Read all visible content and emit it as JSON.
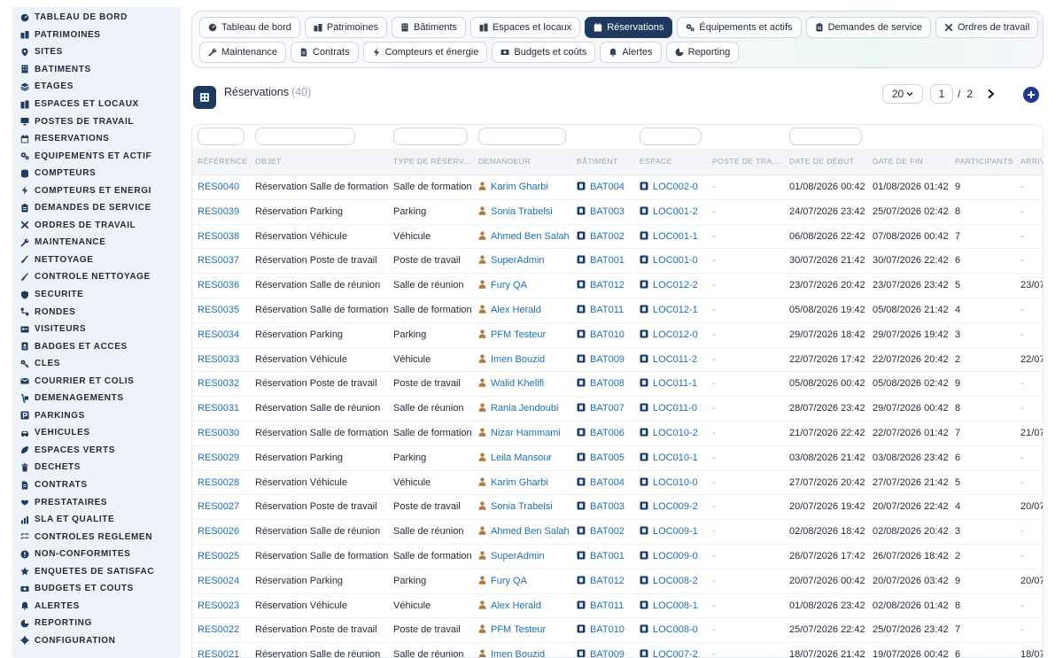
{
  "sidebar": {
    "items": [
      {
        "label": "TABLEAU DE BORD",
        "icon": "dashboard-icon"
      },
      {
        "label": "PATRIMOINES",
        "icon": "building-group-icon"
      },
      {
        "label": "SITES",
        "icon": "location-pin-icon"
      },
      {
        "label": "BÂTIMENTS",
        "icon": "building-icon"
      },
      {
        "label": "ÉTAGES",
        "icon": "layers-icon"
      },
      {
        "label": "ESPACES ET LOCAUX",
        "icon": "rooms-icon"
      },
      {
        "label": "POSTES DE TRAVAIL",
        "icon": "desktop-icon"
      },
      {
        "label": "RÉSERVATIONS",
        "icon": "calendar-icon"
      },
      {
        "label": "ÉQUIPEMENTS ET ACTIF",
        "icon": "cogs-icon"
      },
      {
        "label": "COMPTEURS",
        "icon": "database-icon"
      },
      {
        "label": "COMPTEURS ET ÉNERGI",
        "icon": "bolt-icon"
      },
      {
        "label": "DEMANDES DE SERVICE",
        "icon": "clipboard-icon"
      },
      {
        "label": "ORDRES DE TRAVAIL",
        "icon": "tools-icon"
      },
      {
        "label": "MAINTENANCE",
        "icon": "wrench-icon"
      },
      {
        "label": "NETTOYAGE",
        "icon": "broom-icon"
      },
      {
        "label": "CONTRÔLE NETTOYAGE",
        "icon": "check-broom-icon"
      },
      {
        "label": "SÉCURITÉ",
        "icon": "shield-icon"
      },
      {
        "label": "RONDES",
        "icon": "route-icon"
      },
      {
        "label": "VISITEURS",
        "icon": "id-card-icon"
      },
      {
        "label": "BADGES ET ACCÈS",
        "icon": "badge-icon"
      },
      {
        "label": "CLÉS",
        "icon": "key-icon"
      },
      {
        "label": "COURRIER ET COLIS",
        "icon": "mail-icon"
      },
      {
        "label": "DÉMÉNAGEMENTS",
        "icon": "dolly-icon"
      },
      {
        "label": "PARKINGS",
        "icon": "parking-icon"
      },
      {
        "label": "VÉHICULES",
        "icon": "car-icon"
      },
      {
        "label": "ESPACES VERTS",
        "icon": "leaf-icon"
      },
      {
        "label": "DÉCHETS",
        "icon": "trash-icon"
      },
      {
        "label": "CONTRATS",
        "icon": "document-icon"
      },
      {
        "label": "PRESTATAIRES",
        "icon": "handshake-icon"
      },
      {
        "label": "SLA ET QUALITÉ",
        "icon": "chart-icon"
      },
      {
        "label": "CONTRÔLES RÉGLEMEN",
        "icon": "checklist-icon"
      },
      {
        "label": "NON-CONFORMITÉS",
        "icon": "alert-circle-icon"
      },
      {
        "label": "ENQUÊTES DE SATISFAC",
        "icon": "star-icon"
      },
      {
        "label": "BUDGETS ET COÛTS",
        "icon": "money-icon"
      },
      {
        "label": "ALERTES",
        "icon": "bell-icon"
      },
      {
        "label": "REPORTING",
        "icon": "report-icon"
      },
      {
        "label": "CONFIGURATION",
        "icon": "gear-icon"
      }
    ]
  },
  "tabs": {
    "row1": [
      {
        "label": "Tableau de bord",
        "icon": "dashboard-icon",
        "active": false
      },
      {
        "label": "Patrimoines",
        "icon": "building-group-icon",
        "active": false
      },
      {
        "label": "Bâtiments",
        "icon": "building-icon",
        "active": false
      },
      {
        "label": "Espaces et locaux",
        "icon": "rooms-icon",
        "active": false
      },
      {
        "label": "Réservations",
        "icon": "calendar-icon",
        "active": true
      },
      {
        "label": "Équipements et actifs",
        "icon": "cogs-icon",
        "active": false
      },
      {
        "label": "Demandes de service",
        "icon": "clipboard-icon",
        "active": false
      },
      {
        "label": "Ordres de travail",
        "icon": "tools-icon",
        "active": false
      }
    ],
    "row2": [
      {
        "label": "Maintenance",
        "icon": "wrench-icon",
        "active": false
      },
      {
        "label": "Contrats",
        "icon": "document-icon",
        "active": false
      },
      {
        "label": "Compteurs et énergie",
        "icon": "bolt-icon",
        "active": false
      },
      {
        "label": "Budgets et coûts",
        "icon": "money-icon",
        "active": false
      },
      {
        "label": "Alertes",
        "icon": "bell-icon",
        "active": false
      },
      {
        "label": "Reporting",
        "icon": "report-icon",
        "active": false
      }
    ]
  },
  "header": {
    "title": "Réservations",
    "count": "(40)"
  },
  "pager": {
    "page_size": "20",
    "current_page": "1",
    "separator": "/",
    "total_pages": "2"
  },
  "colors": {
    "accent": "#1e3a5f",
    "link": "#1d6fb8",
    "add_button": "#1e3a8a",
    "person_icon": "#b07a3c"
  },
  "table": {
    "columns": [
      "RÉFÉRENCE",
      "OBJET",
      "TYPE DE RÉSERV...",
      "DEMANDEUR",
      "BÂTIMENT",
      "ESPACE",
      "POSTE DE TRA...",
      "DATE DE DÉBUT",
      "DATE DE FIN",
      "PARTICIPANTS",
      "ARRIV"
    ],
    "rows": [
      {
        "ref": "RES0040",
        "objet": "Réservation Salle de formation",
        "type": "Salle de formation",
        "demandeur": "Karim Gharbi",
        "batiment": "BAT004",
        "espace": "LOC002-0",
        "poste": "-",
        "debut": "01/08/2026 00:42",
        "fin": "01/08/2026 01:42",
        "participants": "9",
        "arrivee": "-"
      },
      {
        "ref": "RES0039",
        "objet": "Réservation Parking",
        "type": "Parking",
        "demandeur": "Sonia Trabelsi",
        "batiment": "BAT003",
        "espace": "LOC001-2",
        "poste": "-",
        "debut": "24/07/2026 23:42",
        "fin": "25/07/2026 02:42",
        "participants": "8",
        "arrivee": "-"
      },
      {
        "ref": "RES0038",
        "objet": "Réservation Véhicule",
        "type": "Véhicule",
        "demandeur": "Ahmed Ben Salah",
        "batiment": "BAT002",
        "espace": "LOC001-1",
        "poste": "-",
        "debut": "06/08/2026 22:42",
        "fin": "07/08/2026 00:42",
        "participants": "7",
        "arrivee": "-"
      },
      {
        "ref": "RES0037",
        "objet": "Réservation Poste de travail",
        "type": "Poste de travail",
        "demandeur": "SuperAdmin",
        "batiment": "BAT001",
        "espace": "LOC001-0",
        "poste": "-",
        "debut": "30/07/2026 21:42",
        "fin": "30/07/2026 22:42",
        "participants": "6",
        "arrivee": "-"
      },
      {
        "ref": "RES0036",
        "objet": "Réservation Salle de réunion",
        "type": "Salle de réunion",
        "demandeur": "Fury QA",
        "batiment": "BAT012",
        "espace": "LOC012-2",
        "poste": "-",
        "debut": "23/07/2026 20:42",
        "fin": "23/07/2026 23:42",
        "participants": "5",
        "arrivee": "23/07"
      },
      {
        "ref": "RES0035",
        "objet": "Réservation Salle de formation",
        "type": "Salle de formation",
        "demandeur": "Alex Herald",
        "batiment": "BAT011",
        "espace": "LOC012-1",
        "poste": "-",
        "debut": "05/08/2026 19:42",
        "fin": "05/08/2026 21:42",
        "participants": "4",
        "arrivee": "-"
      },
      {
        "ref": "RES0034",
        "objet": "Réservation Parking",
        "type": "Parking",
        "demandeur": "PFM Testeur",
        "batiment": "BAT010",
        "espace": "LOC012-0",
        "poste": "-",
        "debut": "29/07/2026 18:42",
        "fin": "29/07/2026 19:42",
        "participants": "3",
        "arrivee": "-"
      },
      {
        "ref": "RES0033",
        "objet": "Réservation Véhicule",
        "type": "Véhicule",
        "demandeur": "Imen Bouzid",
        "batiment": "BAT009",
        "espace": "LOC011-2",
        "poste": "-",
        "debut": "22/07/2026 17:42",
        "fin": "22/07/2026 20:42",
        "participants": "2",
        "arrivee": "22/07"
      },
      {
        "ref": "RES0032",
        "objet": "Réservation Poste de travail",
        "type": "Poste de travail",
        "demandeur": "Walid Khelifi",
        "batiment": "BAT008",
        "espace": "LOC011-1",
        "poste": "-",
        "debut": "05/08/2026 00:42",
        "fin": "05/08/2026 02:42",
        "participants": "9",
        "arrivee": "-"
      },
      {
        "ref": "RES0031",
        "objet": "Réservation Salle de réunion",
        "type": "Salle de réunion",
        "demandeur": "Rania Jendoubi",
        "batiment": "BAT007",
        "espace": "LOC011-0",
        "poste": "-",
        "debut": "28/07/2026 23:42",
        "fin": "29/07/2026 00:42",
        "participants": "8",
        "arrivee": "-"
      },
      {
        "ref": "RES0030",
        "objet": "Réservation Salle de formation",
        "type": "Salle de formation",
        "demandeur": "Nizar Hammami",
        "batiment": "BAT006",
        "espace": "LOC010-2",
        "poste": "-",
        "debut": "21/07/2026 22:42",
        "fin": "22/07/2026 01:42",
        "participants": "7",
        "arrivee": "21/07"
      },
      {
        "ref": "RES0029",
        "objet": "Réservation Parking",
        "type": "Parking",
        "demandeur": "Leila Mansour",
        "batiment": "BAT005",
        "espace": "LOC010-1",
        "poste": "-",
        "debut": "03/08/2026 21:42",
        "fin": "03/08/2026 23:42",
        "participants": "6",
        "arrivee": "-"
      },
      {
        "ref": "RES0028",
        "objet": "Réservation Véhicule",
        "type": "Véhicule",
        "demandeur": "Karim Gharbi",
        "batiment": "BAT004",
        "espace": "LOC010-0",
        "poste": "-",
        "debut": "27/07/2026 20:42",
        "fin": "27/07/2026 21:42",
        "participants": "5",
        "arrivee": "-"
      },
      {
        "ref": "RES0027",
        "objet": "Réservation Poste de travail",
        "type": "Poste de travail",
        "demandeur": "Sonia Trabelsi",
        "batiment": "BAT003",
        "espace": "LOC009-2",
        "poste": "-",
        "debut": "20/07/2026 19:42",
        "fin": "20/07/2026 22:42",
        "participants": "4",
        "arrivee": "20/07"
      },
      {
        "ref": "RES0026",
        "objet": "Réservation Salle de réunion",
        "type": "Salle de réunion",
        "demandeur": "Ahmed Ben Salah",
        "batiment": "BAT002",
        "espace": "LOC009-1",
        "poste": "-",
        "debut": "02/08/2026 18:42",
        "fin": "02/08/2026 20:42",
        "participants": "3",
        "arrivee": "-"
      },
      {
        "ref": "RES0025",
        "objet": "Réservation Salle de formation",
        "type": "Salle de formation",
        "demandeur": "SuperAdmin",
        "batiment": "BAT001",
        "espace": "LOC009-0",
        "poste": "-",
        "debut": "26/07/2026 17:42",
        "fin": "26/07/2026 18:42",
        "participants": "2",
        "arrivee": "-"
      },
      {
        "ref": "RES0024",
        "objet": "Réservation Parking",
        "type": "Parking",
        "demandeur": "Fury QA",
        "batiment": "BAT012",
        "espace": "LOC008-2",
        "poste": "-",
        "debut": "20/07/2026 00:42",
        "fin": "20/07/2026 03:42",
        "participants": "9",
        "arrivee": "20/07"
      },
      {
        "ref": "RES0023",
        "objet": "Réservation Véhicule",
        "type": "Véhicule",
        "demandeur": "Alex Herald",
        "batiment": "BAT011",
        "espace": "LOC008-1",
        "poste": "-",
        "debut": "01/08/2026 23:42",
        "fin": "02/08/2026 01:42",
        "participants": "8",
        "arrivee": "-"
      },
      {
        "ref": "RES0022",
        "objet": "Réservation Poste de travail",
        "type": "Poste de travail",
        "demandeur": "PFM Testeur",
        "batiment": "BAT010",
        "espace": "LOC008-0",
        "poste": "-",
        "debut": "25/07/2026 22:42",
        "fin": "25/07/2026 23:42",
        "participants": "7",
        "arrivee": "-"
      },
      {
        "ref": "RES0021",
        "objet": "Réservation Salle de réunion",
        "type": "Salle de réunion",
        "demandeur": "Imen Bouzid",
        "batiment": "BAT009",
        "espace": "LOC007-2",
        "poste": "-",
        "debut": "18/07/2026 21:42",
        "fin": "19/07/2026 00:42",
        "participants": "6",
        "arrivee": "18/07"
      }
    ]
  }
}
